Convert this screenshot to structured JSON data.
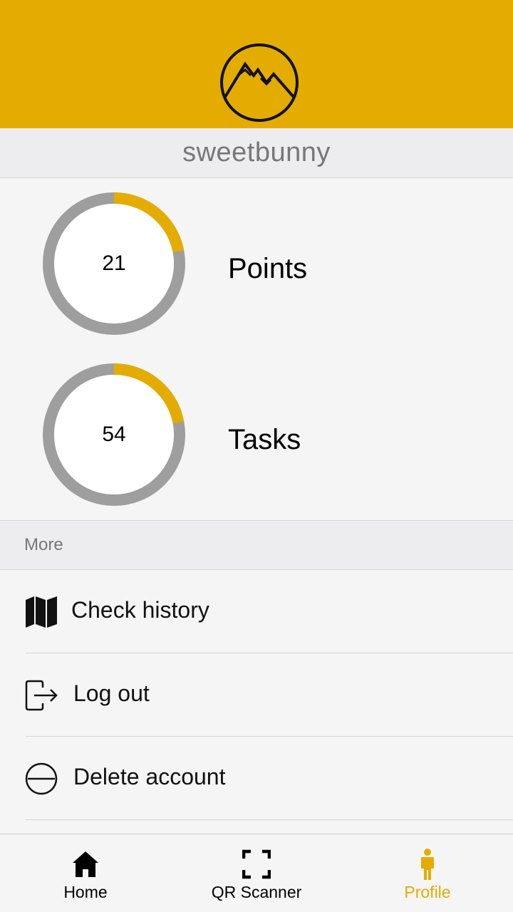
{
  "profile": {
    "username": "sweetbunny",
    "logo_icon": "mountain-logo-icon"
  },
  "stats": [
    {
      "value": "21",
      "label": "Points",
      "progress": 0.22
    },
    {
      "value": "54",
      "label": "Tasks",
      "progress": 0.22
    }
  ],
  "more_section": {
    "title": "More",
    "items": [
      {
        "label": "Check history",
        "icon": "map-icon"
      },
      {
        "label": "Log out",
        "icon": "logout-icon"
      },
      {
        "label": "Delete account",
        "icon": "minus-circle-icon"
      }
    ]
  },
  "tabbar": {
    "active": "Profile",
    "tabs": [
      {
        "label": "Home",
        "icon": "home-icon"
      },
      {
        "label": "QR Scanner",
        "icon": "qr-scan-icon"
      },
      {
        "label": "Profile",
        "icon": "person-icon"
      }
    ]
  },
  "colors": {
    "accent": "#e5ac00",
    "ring_track": "#9e9e9e",
    "header_bar": "#ededf0",
    "background": "#f5f5f5"
  }
}
